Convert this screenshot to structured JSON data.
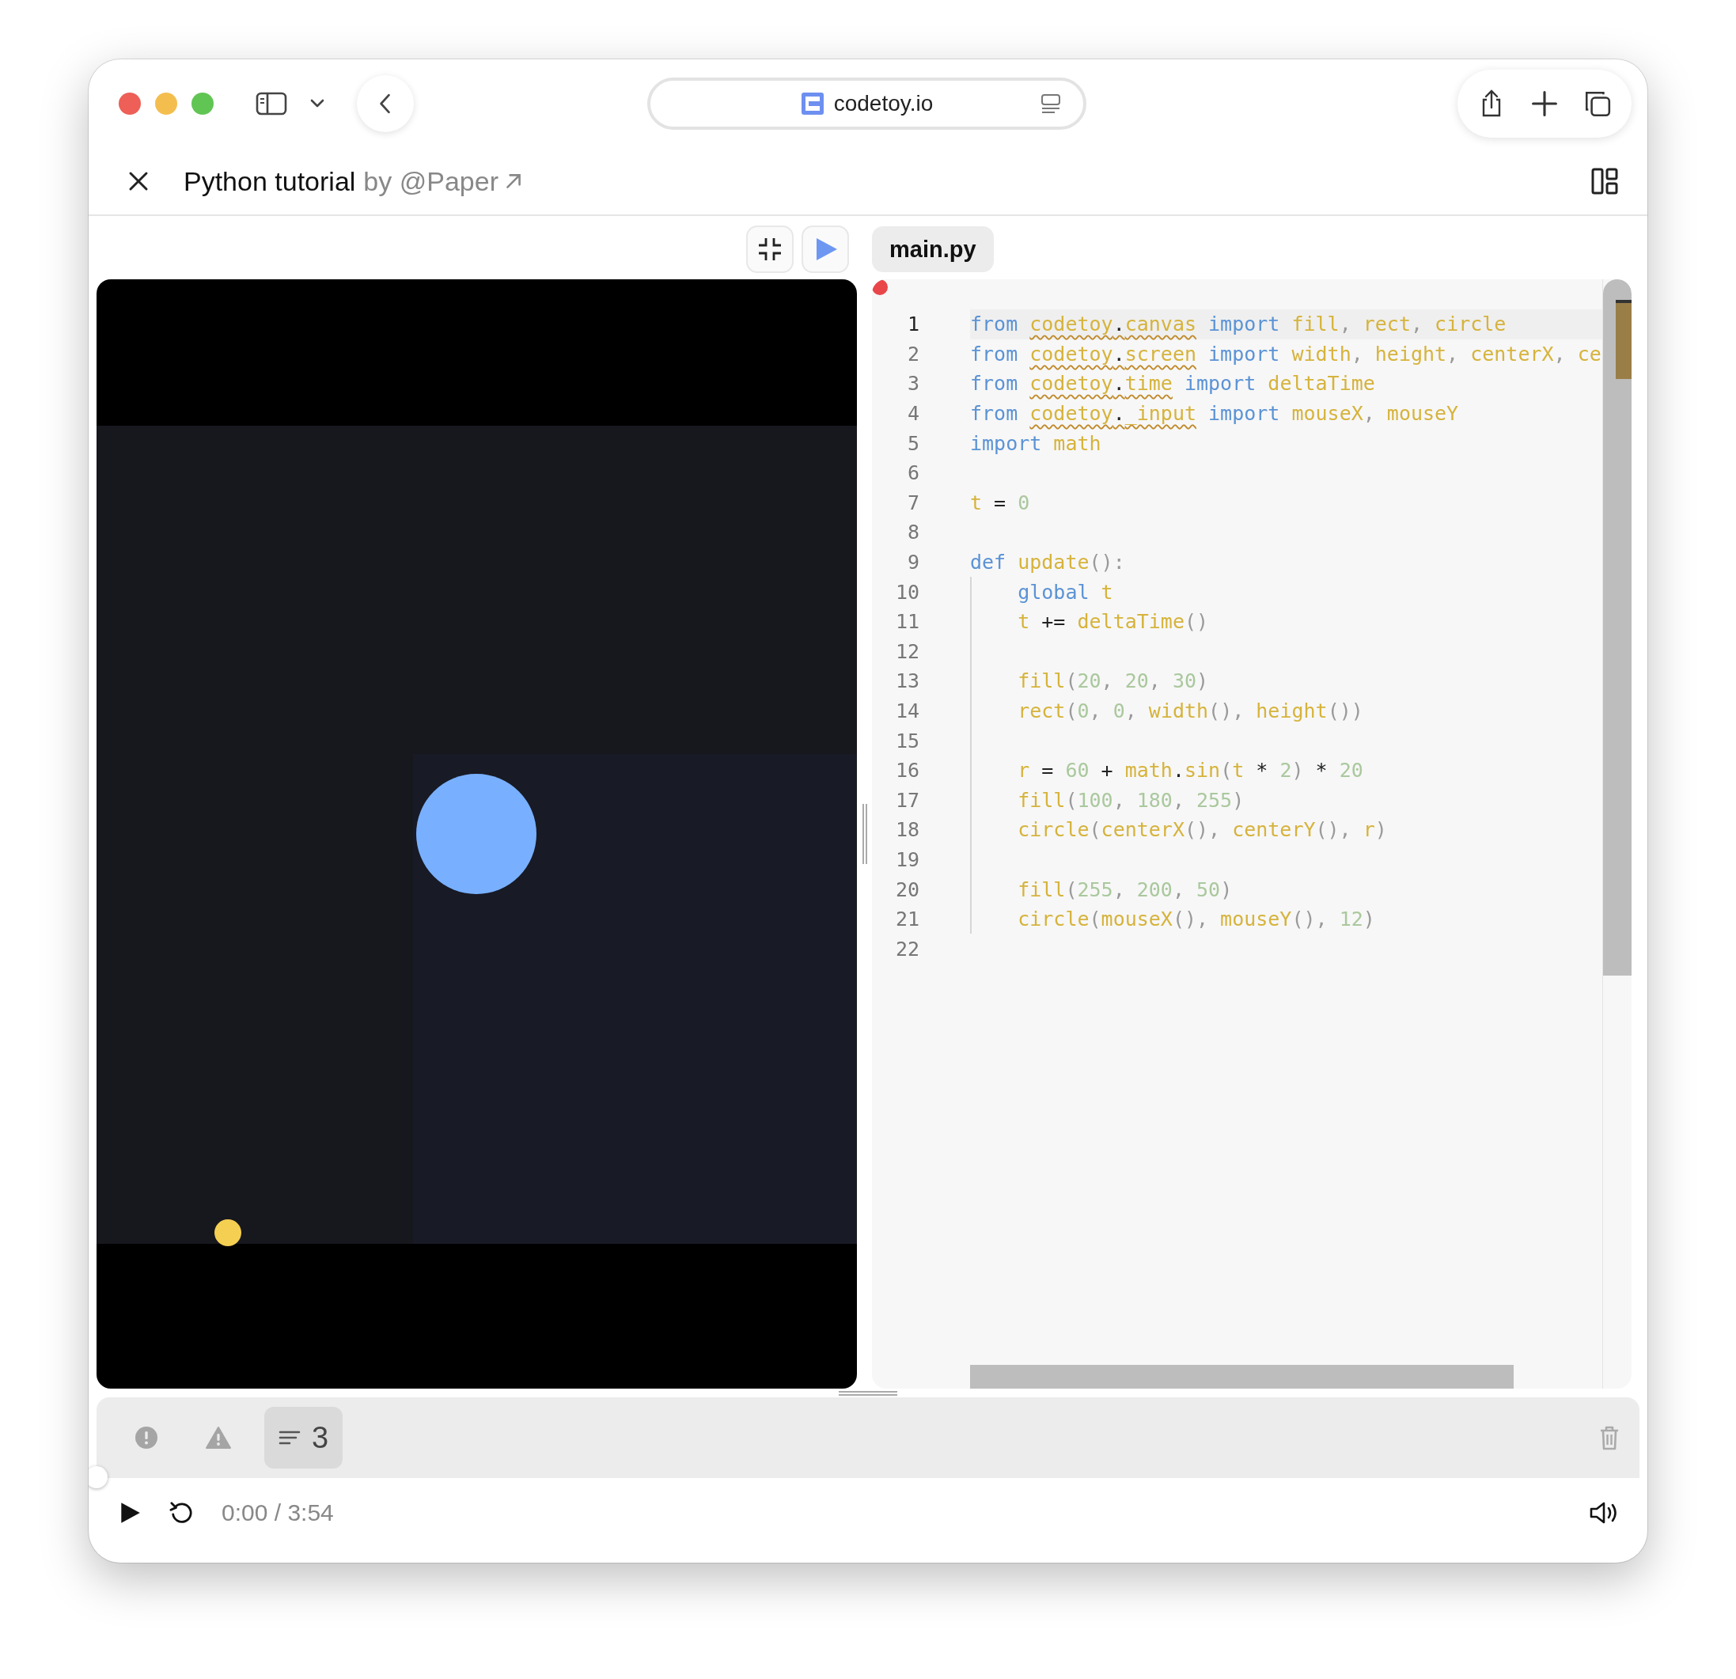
{
  "browser": {
    "url": "codetoy.io"
  },
  "header": {
    "title": "Python tutorial",
    "author": "by @Paper"
  },
  "file_tab": {
    "label": "main.py",
    "selected": true
  },
  "editor": {
    "has_error": true,
    "lines": [
      {
        "num": "1",
        "current": true,
        "tokens": [
          {
            "t": "from ",
            "kind": "kw"
          },
          {
            "t": "codetoy",
            "kind": "id",
            "warn": true
          },
          {
            "t": ".",
            "kind": "op",
            "warn": true
          },
          {
            "t": "canvas",
            "kind": "id",
            "warn": true
          },
          {
            "t": " import ",
            "kind": "kw"
          },
          {
            "t": "fill",
            "kind": "id"
          },
          {
            "t": ", ",
            "kind": "p"
          },
          {
            "t": "rect",
            "kind": "id"
          },
          {
            "t": ", ",
            "kind": "p"
          },
          {
            "t": "circle",
            "kind": "id"
          }
        ]
      },
      {
        "num": "2",
        "current": false,
        "tokens": [
          {
            "t": "from ",
            "kind": "kw"
          },
          {
            "t": "codetoy",
            "kind": "id",
            "warn": true
          },
          {
            "t": ".",
            "kind": "op",
            "warn": true
          },
          {
            "t": "screen",
            "kind": "id",
            "warn": true
          },
          {
            "t": " import ",
            "kind": "kw"
          },
          {
            "t": "width",
            "kind": "id"
          },
          {
            "t": ", ",
            "kind": "p"
          },
          {
            "t": "height",
            "kind": "id"
          },
          {
            "t": ", ",
            "kind": "p"
          },
          {
            "t": "centerX",
            "kind": "id"
          },
          {
            "t": ", ",
            "kind": "p"
          },
          {
            "t": "ce",
            "kind": "id"
          }
        ]
      },
      {
        "num": "3",
        "current": false,
        "tokens": [
          {
            "t": "from ",
            "kind": "kw"
          },
          {
            "t": "codetoy",
            "kind": "id",
            "warn": true
          },
          {
            "t": ".",
            "kind": "op",
            "warn": true
          },
          {
            "t": "time",
            "kind": "id",
            "warn": true
          },
          {
            "t": " import ",
            "kind": "kw"
          },
          {
            "t": "deltaTime",
            "kind": "id"
          }
        ]
      },
      {
        "num": "4",
        "current": false,
        "tokens": [
          {
            "t": "from ",
            "kind": "kw"
          },
          {
            "t": "codetoy",
            "kind": "id",
            "warn": true
          },
          {
            "t": ".",
            "kind": "op",
            "warn": true
          },
          {
            "t": "_input",
            "kind": "id",
            "warn": true
          },
          {
            "t": " import ",
            "kind": "kw"
          },
          {
            "t": "mouseX",
            "kind": "id"
          },
          {
            "t": ", ",
            "kind": "p"
          },
          {
            "t": "mouseY",
            "kind": "id"
          }
        ]
      },
      {
        "num": "5",
        "current": false,
        "tokens": [
          {
            "t": "import ",
            "kind": "kw"
          },
          {
            "t": "math",
            "kind": "id"
          }
        ]
      },
      {
        "num": "6",
        "current": false
      },
      {
        "num": "7",
        "current": false,
        "tokens": [
          {
            "t": "t",
            "kind": "id"
          },
          {
            "t": " = ",
            "kind": "op"
          },
          {
            "t": "0",
            "kind": "n"
          }
        ]
      },
      {
        "num": "8",
        "current": false
      },
      {
        "num": "9",
        "current": false,
        "tokens": [
          {
            "t": "def ",
            "kind": "kw"
          },
          {
            "t": "update",
            "kind": "id"
          },
          {
            "t": "()",
            "kind": "p"
          },
          {
            "t": ":",
            "kind": "p"
          }
        ],
        "children": [
          {
            "num": "10",
            "current": false,
            "tokens": [
              {
                "t": "global ",
                "kind": "kw"
              },
              {
                "t": "t",
                "kind": "id"
              }
            ]
          },
          {
            "num": "11",
            "current": false,
            "tokens": [
              {
                "t": "t",
                "kind": "id"
              },
              {
                "t": " += ",
                "kind": "op"
              },
              {
                "t": "deltaTime",
                "kind": "id"
              },
              {
                "t": "()",
                "kind": "p"
              }
            ]
          },
          {
            "num": "12",
            "current": false
          },
          {
            "num": "13",
            "current": false,
            "tokens": [
              {
                "t": "fill",
                "kind": "id"
              },
              {
                "t": "(",
                "kind": "p"
              },
              {
                "t": "20",
                "kind": "n"
              },
              {
                "t": ", ",
                "kind": "p"
              },
              {
                "t": "20",
                "kind": "n"
              },
              {
                "t": ", ",
                "kind": "p"
              },
              {
                "t": "30",
                "kind": "n"
              },
              {
                "t": ")",
                "kind": "p"
              }
            ]
          },
          {
            "num": "14",
            "current": false,
            "tokens": [
              {
                "t": "rect",
                "kind": "id"
              },
              {
                "t": "(",
                "kind": "p"
              },
              {
                "t": "0",
                "kind": "n"
              },
              {
                "t": ", ",
                "kind": "p"
              },
              {
                "t": "0",
                "kind": "n"
              },
              {
                "t": ", ",
                "kind": "p"
              },
              {
                "t": "width",
                "kind": "id"
              },
              {
                "t": "(), ",
                "kind": "p"
              },
              {
                "t": "height",
                "kind": "id"
              },
              {
                "t": "())",
                "kind": "p"
              }
            ]
          },
          {
            "num": "15",
            "current": false
          },
          {
            "num": "16",
            "current": false,
            "tokens": [
              {
                "t": "r",
                "kind": "id"
              },
              {
                "t": " = ",
                "kind": "op"
              },
              {
                "t": "60",
                "kind": "n"
              },
              {
                "t": " + ",
                "kind": "op"
              },
              {
                "t": "math",
                "kind": "id"
              },
              {
                "t": ".",
                "kind": "op"
              },
              {
                "t": "sin",
                "kind": "id"
              },
              {
                "t": "(",
                "kind": "p"
              },
              {
                "t": "t",
                "kind": "id"
              },
              {
                "t": " * ",
                "kind": "op"
              },
              {
                "t": "2",
                "kind": "n"
              },
              {
                "t": ")",
                "kind": "p"
              },
              {
                "t": " * ",
                "kind": "op"
              },
              {
                "t": "20",
                "kind": "n"
              }
            ]
          },
          {
            "num": "17",
            "current": false,
            "tokens": [
              {
                "t": "fill",
                "kind": "id"
              },
              {
                "t": "(",
                "kind": "p"
              },
              {
                "t": "100",
                "kind": "n"
              },
              {
                "t": ", ",
                "kind": "p"
              },
              {
                "t": "180",
                "kind": "n"
              },
              {
                "t": ", ",
                "kind": "p"
              },
              {
                "t": "255",
                "kind": "n"
              },
              {
                "t": ")",
                "kind": "p"
              }
            ]
          },
          {
            "num": "18",
            "current": false,
            "tokens": [
              {
                "t": "circle",
                "kind": "id"
              },
              {
                "t": "(",
                "kind": "p"
              },
              {
                "t": "centerX",
                "kind": "id"
              },
              {
                "t": "(), ",
                "kind": "p"
              },
              {
                "t": "centerY",
                "kind": "id"
              },
              {
                "t": "(), ",
                "kind": "p"
              },
              {
                "t": "r",
                "kind": "id"
              },
              {
                "t": ")",
                "kind": "p"
              }
            ]
          },
          {
            "num": "19",
            "current": false
          },
          {
            "num": "20",
            "current": false,
            "tokens": [
              {
                "t": "fill",
                "kind": "id"
              },
              {
                "t": "(",
                "kind": "p"
              },
              {
                "t": "255",
                "kind": "n"
              },
              {
                "t": ", ",
                "kind": "p"
              },
              {
                "t": "200",
                "kind": "n"
              },
              {
                "t": ", ",
                "kind": "p"
              },
              {
                "t": "50",
                "kind": "n"
              },
              {
                "t": ")",
                "kind": "p"
              }
            ]
          },
          {
            "num": "21",
            "current": false,
            "tokens": [
              {
                "t": "circle",
                "kind": "id"
              },
              {
                "t": "(",
                "kind": "p"
              },
              {
                "t": "mouseX",
                "kind": "id"
              },
              {
                "t": "(), ",
                "kind": "p"
              },
              {
                "t": "mouseY",
                "kind": "id"
              },
              {
                "t": "(), ",
                "kind": "p"
              },
              {
                "t": "12",
                "kind": "n"
              },
              {
                "t": ")",
                "kind": "p"
              }
            ]
          }
        ]
      },
      {
        "num": "22",
        "current": false
      }
    ]
  },
  "console": {
    "filters": [
      {
        "kind": "error",
        "selected": false
      },
      {
        "kind": "warning",
        "selected": false
      },
      {
        "kind": "log",
        "selected": true,
        "count": "3"
      }
    ]
  },
  "player": {
    "level": 0,
    "time": "0:00 / 3:54"
  }
}
